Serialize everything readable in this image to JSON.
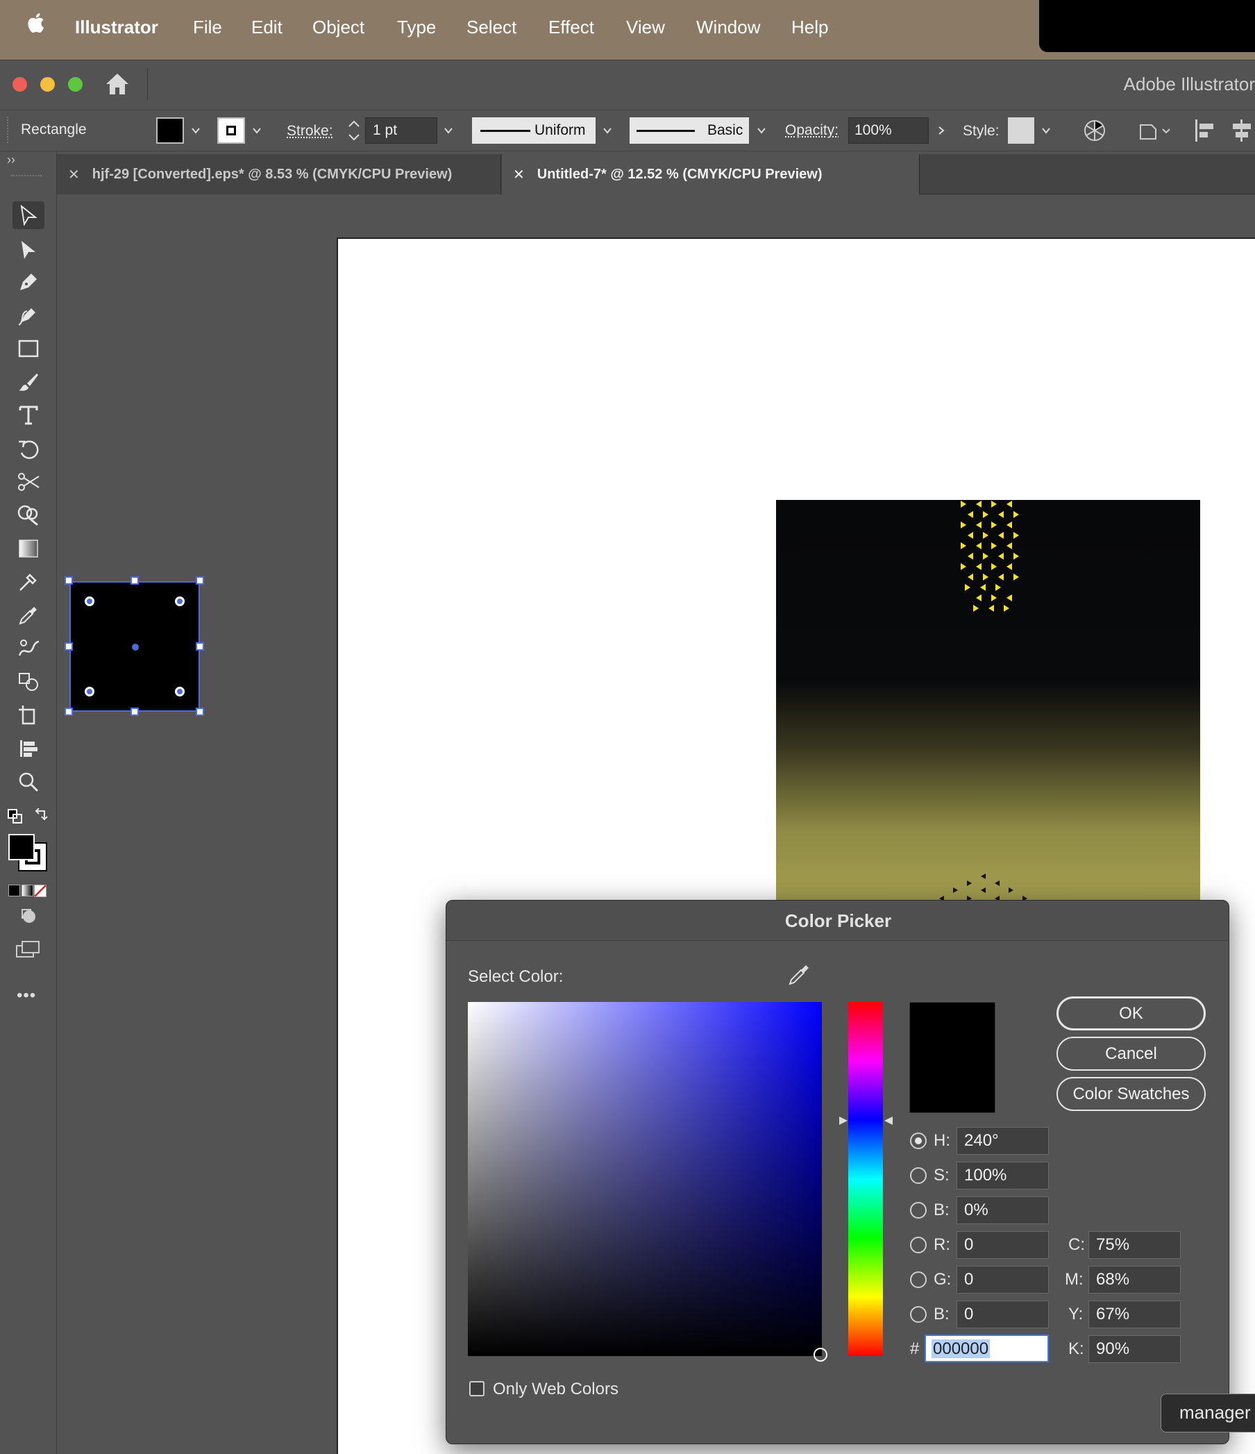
{
  "menubar": {
    "app": "Illustrator",
    "items": [
      "File",
      "Edit",
      "Object",
      "Type",
      "Select",
      "Effect",
      "View",
      "Window",
      "Help"
    ]
  },
  "window": {
    "title": "Adobe Illustrator"
  },
  "control_bar": {
    "tool_name": "Rectangle",
    "stroke_label": "Stroke:",
    "stroke_weight": "1 pt",
    "profile": "Uniform",
    "brush": "Basic",
    "opacity_label": "Opacity:",
    "opacity_value": "100%",
    "style_label": "Style:"
  },
  "tabs": [
    {
      "title": "hjf-29 [Converted].eps* @ 8.53 % (CMYK/CPU Preview)",
      "active": false
    },
    {
      "title": "Untitled-7* @ 12.52 % (CMYK/CPU Preview)",
      "active": true
    }
  ],
  "toolbar": {
    "tools": [
      "selection-tool",
      "direct-selection-tool",
      "pen-tool",
      "curvature-tool",
      "rectangle-tool",
      "paintbrush-tool",
      "type-tool",
      "rotate-tool",
      "scissors-tool",
      "shape-builder-tool",
      "gradient-tool",
      "eyedropper-tool",
      "blend-tool",
      "puppet-warp-tool",
      "symbol-sprayer-tool",
      "artboard-tool",
      "column-graph-tool",
      "zoom-tool"
    ],
    "fill_color": "#000000",
    "stroke_color": "#ffffff",
    "more": "•••"
  },
  "color_picker": {
    "title": "Color Picker",
    "select_color_label": "Select Color:",
    "buttons": {
      "ok": "OK",
      "cancel": "Cancel",
      "swatches": "Color Swatches"
    },
    "hsb": {
      "h_label": "H:",
      "h": "240°",
      "s_label": "S:",
      "s": "100%",
      "b_label": "B:",
      "b": "0%"
    },
    "rgb": {
      "r_label": "R:",
      "r": "0",
      "g_label": "G:",
      "g": "0",
      "b_label": "B:",
      "b": "0"
    },
    "hex_label": "#",
    "hex": "000000",
    "cmyk": {
      "c_label": "C:",
      "c": "75%",
      "m_label": "M:",
      "m": "68%",
      "y_label": "Y:",
      "y": "67%",
      "k_label": "K:",
      "k": "90%"
    },
    "only_web_colors": "Only Web Colors",
    "selected_radio": "H",
    "current_color": "#000000",
    "field_hue_color": "#0000ff"
  },
  "tooltip": {
    "text": "manager"
  },
  "colors": {
    "menubar": "#8b7b66",
    "ui_gray": "#535353",
    "selection_blue": "#4a6bd8",
    "pattern_yellow": "#f2e02a"
  }
}
